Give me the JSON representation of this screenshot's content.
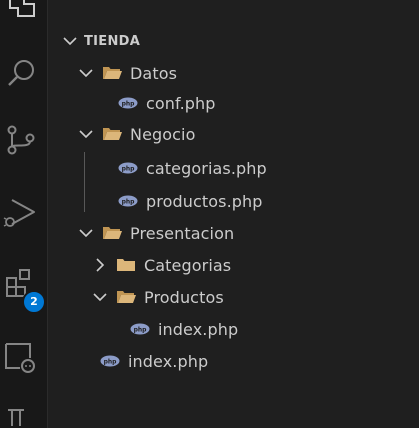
{
  "colors": {
    "folder": "#dcb67a",
    "php_icon": "#8c9cc8",
    "badge": "#0078d4",
    "text": "#cccccc"
  },
  "activity_bar": {
    "icons": [
      "explorer-icon",
      "search-icon",
      "source-control-icon",
      "run-debug-icon",
      "extensions-icon",
      "remote-explorer-icon",
      "testing-icon"
    ],
    "extensions_badge": "2"
  },
  "explorer": {
    "root": {
      "label": "TIENDA",
      "expanded": true
    },
    "items": [
      {
        "label": "Datos",
        "type": "folder",
        "expanded": true,
        "depth": 1
      },
      {
        "label": "conf.php",
        "type": "php",
        "depth": 2
      },
      {
        "label": "Negocio",
        "type": "folder",
        "expanded": true,
        "depth": 1
      },
      {
        "label": "categorias.php",
        "type": "php",
        "depth": 2
      },
      {
        "label": "productos.php",
        "type": "php",
        "depth": 2
      },
      {
        "label": "Presentacion",
        "type": "folder",
        "expanded": true,
        "depth": 1
      },
      {
        "label": "Categorias",
        "type": "folder",
        "expanded": false,
        "depth": 2
      },
      {
        "label": "Productos",
        "type": "folder",
        "expanded": true,
        "depth": 2
      },
      {
        "label": "index.php",
        "type": "php",
        "depth": 3
      },
      {
        "label": "index.php",
        "type": "php",
        "depth": 1
      }
    ]
  }
}
